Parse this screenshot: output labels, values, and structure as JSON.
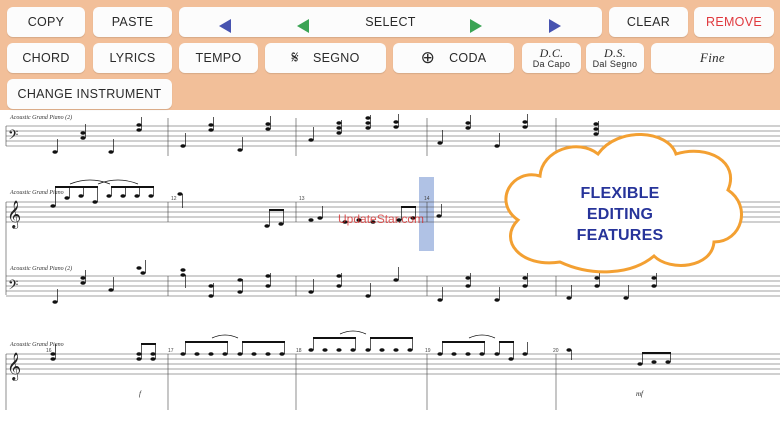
{
  "toolbar": {
    "copy": "COPY",
    "paste": "PASTE",
    "select": "SELECT",
    "clear": "CLEAR",
    "remove": "REMOVE",
    "chord": "CHORD",
    "lyrics": "LYRICS",
    "tempo": "TEMPO",
    "segno": "SEGNO",
    "segno_glyph": "𝄋",
    "coda": "CODA",
    "coda_glyph": "⊕",
    "dc_big": "D.C.",
    "dc_small": "Da Capo",
    "ds_big": "D.S.",
    "ds_small": "Dal Segno",
    "fine": "Fine",
    "change_instrument": "CHANGE INSTRUMENT"
  },
  "colors": {
    "toolbar_bg": "#f2bf99",
    "arrow_blue": "#4753b0",
    "arrow_green": "#3aa454",
    "remove_red": "#e0393e",
    "selection": "#6f8fd0",
    "cloud_stroke": "#f3a032",
    "cloud_text": "#27349a"
  },
  "icons": {
    "prev_far": "triangle-left-blue-icon",
    "prev": "triangle-left-green-icon",
    "next": "triangle-right-green-icon",
    "next_far": "triangle-right-blue-icon"
  },
  "score": {
    "instrument": "Acoustic Grand Piano",
    "instrument_2": "Acoustic Grand Piano (2)",
    "measures_row2": [
      "12",
      "13",
      "14"
    ],
    "measures_row4": [
      "16",
      "17",
      "18",
      "19",
      "20"
    ],
    "dynamic_f": "f",
    "dynamic_mf": "mf",
    "treble_glyph": "𝄞",
    "bass_glyph": "𝄢"
  },
  "callout": {
    "line1": "FLEXIBLE",
    "line2": "EDITING FEATURES"
  },
  "watermark": "UpdateStar.com"
}
